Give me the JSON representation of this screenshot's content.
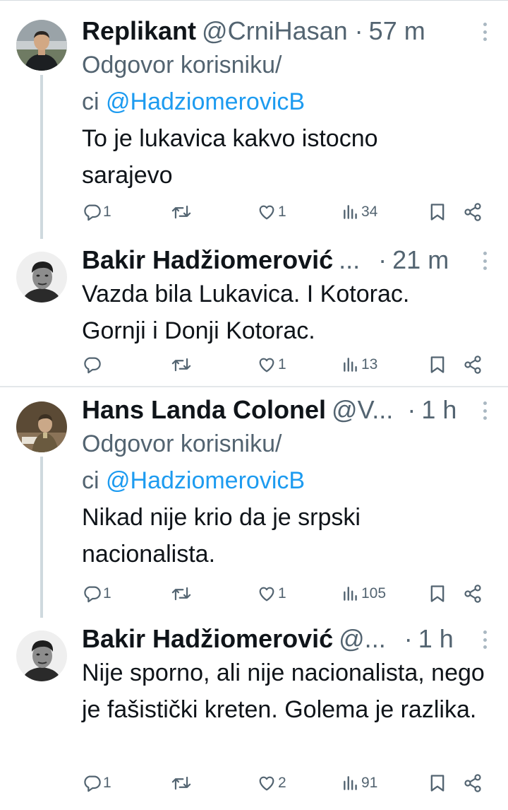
{
  "tweets": [
    {
      "name": "Replikant",
      "handle": "@CrniHasan",
      "dot": "·",
      "time": "57 m",
      "reply_prefix": "Odgovor korisniku/",
      "reply_line2_prefix": "ci ",
      "reply_mention": "@HadziomerovicB",
      "text": "To je lukavica kakvo istocno sarajevo",
      "replies": "1",
      "retweets": "",
      "likes": "1",
      "views": "34"
    },
    {
      "name": "Bakir Hadžiomerović",
      "handle": "...",
      "dot": "·",
      "time": "21 m",
      "text": "Vazda bila Lukavica. I Kotorac. Gornji i Donji Kotorac.",
      "replies": "",
      "retweets": "",
      "likes": "1",
      "views": "13"
    },
    {
      "name": "Hans Landa Colonel",
      "handle": "@V...",
      "dot": "·",
      "time": "1 h",
      "reply_prefix": "Odgovor korisniku/",
      "reply_line2_prefix": "ci ",
      "reply_mention": "@HadziomerovicB",
      "text": "Nikad nije krio da je srpski nacionalista.",
      "replies": "1",
      "retweets": "",
      "likes": "1",
      "views": "105"
    },
    {
      "name": "Bakir Hadžiomerović",
      "handle": "@...",
      "dot": "·",
      "time": "1 h",
      "text": "Nije sporno, ali nije nacionalista, nego je fašistički kreten. Golema je razlika.",
      "replies": "1",
      "retweets": "",
      "likes": "2",
      "views": "91"
    }
  ],
  "icons": {
    "reply": "reply-icon",
    "retweet": "retweet-icon",
    "like": "heart-icon",
    "views": "views-icon",
    "bookmark": "bookmark-icon",
    "share": "share-icon",
    "more": "more-icon"
  },
  "colors": {
    "text": "#0f1419",
    "secondary": "#536471",
    "link": "#1d9bf0",
    "thread": "#cfd9de"
  }
}
